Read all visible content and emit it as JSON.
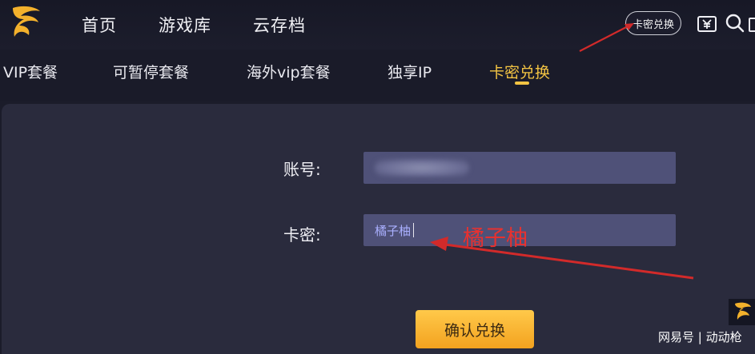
{
  "topnav": {
    "items": [
      "首页",
      "游戏库",
      "云存档"
    ],
    "redeem_label": "卡密兑换"
  },
  "subnav": {
    "tabs": [
      "VIP套餐",
      "可暂停套餐",
      "海外vip套餐",
      "独享IP",
      "卡密兑换"
    ],
    "active_index": 4
  },
  "form": {
    "account_label": "账号:",
    "card_label": "卡密:",
    "card_value": "橘子柚",
    "confirm_label": "确认兑换"
  },
  "annotation": {
    "text": "橘子柚",
    "color": "#e8312f"
  },
  "watermark": {
    "text": "网易号 | 动动枪"
  },
  "colors": {
    "accent": "#f3c443",
    "field_bg": "#4f5178",
    "button": "#f3a21f"
  }
}
